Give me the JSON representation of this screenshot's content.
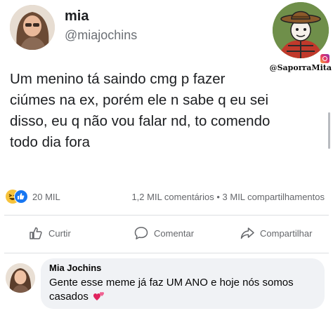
{
  "tweet": {
    "author_name": "mia",
    "author_handle": "@miajochins",
    "lines": [
      "Um menino tá saindo cmg p fazer",
      "ciúmes na ex, porém ele n sabe q eu sei",
      "disso, eu q não vou falar nd, to comendo",
      "todo dia fora"
    ]
  },
  "watermark": {
    "handle": "@SaporraMita",
    "icon": "instagram-icon"
  },
  "post_stats": {
    "reaction_icons": [
      "haha-reaction-icon",
      "like-reaction-icon"
    ],
    "reaction_count": "20 MIL",
    "comments_shares": "1,2 MIL comentários • 3 MIL compartilhamentos"
  },
  "actions": {
    "like_label": "Curtir",
    "comment_label": "Comentar",
    "share_label": "Compartilhar"
  },
  "comment": {
    "author": "Mia Jochins",
    "lines": [
      "Gente esse meme já faz UM ANO e hoje nós somos",
      "casados"
    ],
    "emoji": "revolving-hearts-emoji"
  },
  "colors": {
    "like_blue": "#1877f2",
    "haha_yellow": "#f7c33b",
    "secondary_text": "#65676b",
    "bubble_bg": "#f0f2f5"
  }
}
